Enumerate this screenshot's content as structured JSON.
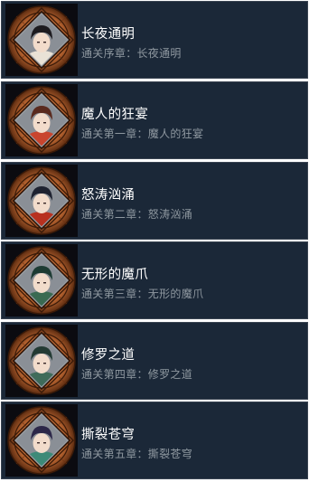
{
  "achievements": [
    {
      "title": "长夜通明",
      "description": "通关序章：长夜通明",
      "icon": "achievement-portrait-icon",
      "accent": "#e9e2d6",
      "hair": "#1d1b1f"
    },
    {
      "title": "魔人的狂宴",
      "description": "通关第一章：魔人的狂宴",
      "icon": "achievement-portrait-icon",
      "accent": "#c9452e",
      "hair": "#5a2a1e"
    },
    {
      "title": "怒涛汹涌",
      "description": "通关第二章：怒涛汹涌",
      "icon": "achievement-portrait-icon",
      "accent": "#b8311f",
      "hair": "#1e2230"
    },
    {
      "title": "无形的魔爪",
      "description": "通关第三章：无形的魔爪",
      "icon": "achievement-portrait-icon",
      "accent": "#3a6a52",
      "hair": "#1d3b33"
    },
    {
      "title": "修罗之道",
      "description": "通关第四章：修罗之道",
      "icon": "achievement-portrait-icon",
      "accent": "#3f6b5a",
      "hair": "#233a33"
    },
    {
      "title": "撕裂苍穹",
      "description": "通关第五章：撕裂苍穹",
      "icon": "achievement-portrait-icon",
      "accent": "#3d8a78",
      "hair": "#2c2748"
    }
  ]
}
